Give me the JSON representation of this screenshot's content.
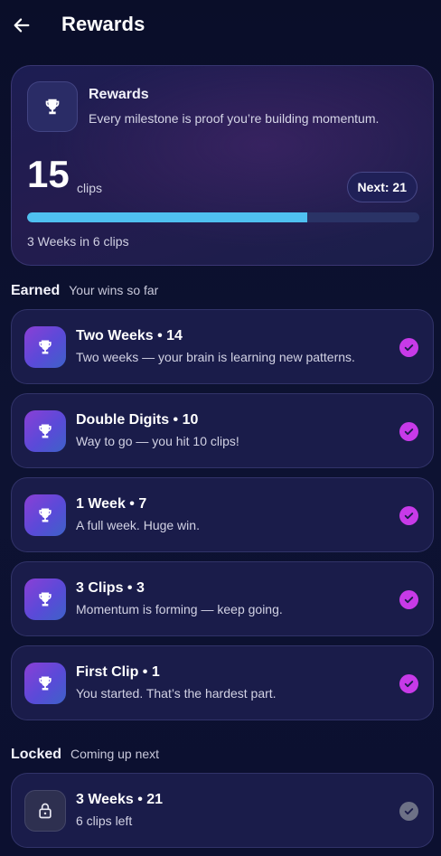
{
  "header": {
    "title": "Rewards",
    "back_icon": "arrow-left-icon"
  },
  "hero": {
    "title": "Rewards",
    "subtitle": "Every milestone is proof you’re building momentum.",
    "count": "15",
    "unit": "clips",
    "next_label": "Next: 21",
    "progress_fraction": 0.714,
    "footer": "3 Weeks in 6 clips",
    "icon": "trophy-icon"
  },
  "earned": {
    "title": "Earned",
    "subtitle": "Your wins so far",
    "items": [
      {
        "title": "Two Weeks • 14",
        "desc": "Two weeks — your brain is learning new patterns.",
        "icon": "trophy-icon",
        "status": "check-icon"
      },
      {
        "title": "Double Digits • 10",
        "desc": "Way to go — you hit 10 clips!",
        "icon": "trophy-icon",
        "status": "check-icon"
      },
      {
        "title": "1 Week • 7",
        "desc": "A full week. Huge win.",
        "icon": "trophy-icon",
        "status": "check-icon"
      },
      {
        "title": "3 Clips • 3",
        "desc": "Momentum is forming — keep going.",
        "icon": "trophy-icon",
        "status": "check-icon"
      },
      {
        "title": "First Clip • 1",
        "desc": "You started. That’s the hardest part.",
        "icon": "trophy-icon",
        "status": "check-icon"
      }
    ]
  },
  "locked": {
    "title": "Locked",
    "subtitle": "Coming up next",
    "items": [
      {
        "title": "3 Weeks • 21",
        "desc": "6 clips left",
        "icon": "lock-icon",
        "status": "check-icon"
      }
    ]
  },
  "colors": {
    "accent_progress": "#4fc0f0",
    "check": "#c73ae8",
    "check_locked": "#6d7186",
    "background": "#0b0f2a"
  }
}
